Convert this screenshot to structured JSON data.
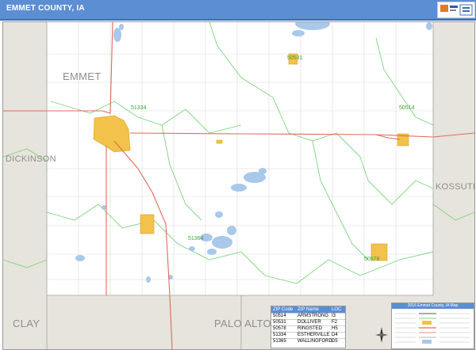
{
  "header": {
    "title": "EMMET COUNTY, IA"
  },
  "counties": {
    "emmet": "EMMET",
    "dickinson": "DICKINSON",
    "kossuth": "KOSSUTH",
    "clay": "CLAY",
    "palo_alto": "PALO ALTO"
  },
  "zip_labels": [
    "50531",
    "51334",
    "50514",
    "51364",
    "50578"
  ],
  "legend": {
    "headers": [
      "ZIP Code",
      "ZIP Name",
      "LOC"
    ],
    "rows": [
      {
        "zip": "50514",
        "name": "ARMSTRONG",
        "loc": "I3"
      },
      {
        "zip": "50531",
        "name": "DOLLIVER",
        "loc": "F2"
      },
      {
        "zip": "50578",
        "name": "RINGSTED",
        "loc": "H5"
      },
      {
        "zip": "51334",
        "name": "ESTHERVILLE",
        "loc": "D4"
      },
      {
        "zip": "51365",
        "name": "WALLINGFORD",
        "loc": "D5"
      }
    ]
  },
  "info_box": {
    "title": "2016 Emmet County, IA Map"
  },
  "colors": {
    "title_bar": "#5b8ed3",
    "county_fill": "#ffffff",
    "outside_fill": "#e6e4dc",
    "road": "#e06a5a",
    "zip_boundary": "#7ed47e",
    "water": "#a9c8ea",
    "town": "#f2c24a"
  }
}
